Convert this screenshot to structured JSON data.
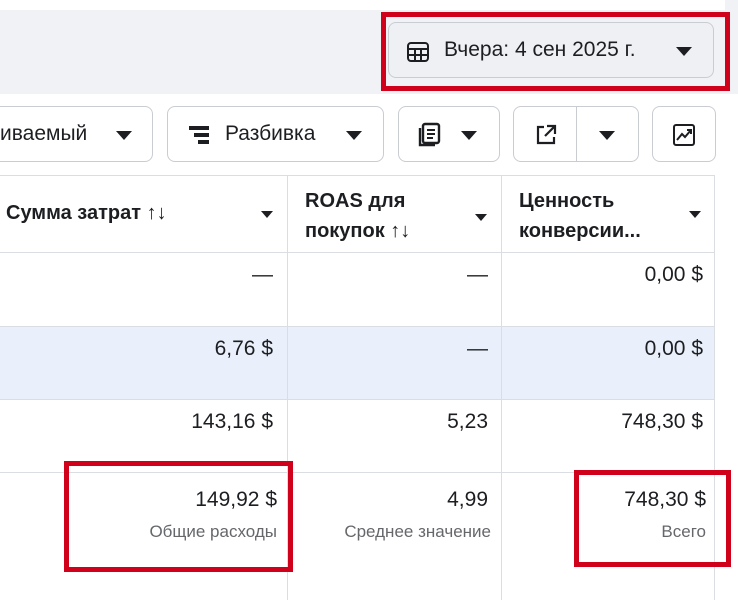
{
  "date_range": {
    "label": "Вчера: 4 сен 2025 г.",
    "icon": "calendar-icon"
  },
  "toolbar": {
    "attribution_label": "иваемый",
    "breakdown_label": "Разбивка",
    "reports_icon": "reports-icon",
    "export_icon": "export-icon",
    "chart_icon": "trend-chart-icon"
  },
  "columns": [
    {
      "title": "Сумма затрат ↑↓"
    },
    {
      "title_line1": "ROAS для",
      "title_line2": "покупок ↑↓"
    },
    {
      "title_line1": "Ценность",
      "title_line2": "конверсии..."
    }
  ],
  "rows": [
    {
      "spend": "—",
      "roas": "—",
      "value": "0,00 $"
    },
    {
      "spend": "6,76 $",
      "roas": "—",
      "value": "0,00 $"
    },
    {
      "spend": "143,16 $",
      "roas": "5,23",
      "value": "748,30 $"
    }
  ],
  "totals": {
    "spend": "149,92 $",
    "spend_caption": "Общие расходы",
    "roas": "4,99",
    "roas_caption": "Среднее значение",
    "value": "748,30 $",
    "value_caption": "Всего"
  },
  "colors": {
    "highlight": "#d0021b",
    "selected_row": "#eaf0fb",
    "border": "#dadde1"
  }
}
